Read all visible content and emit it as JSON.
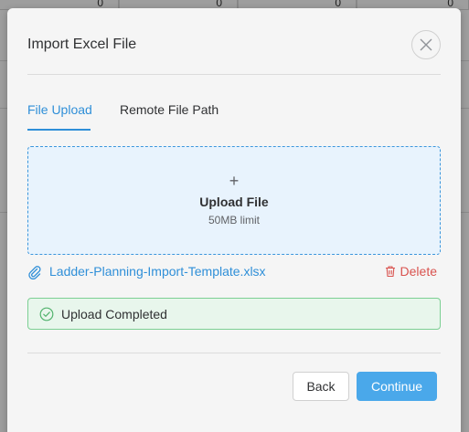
{
  "background": {
    "row_values": [
      "0",
      "0",
      "0",
      "0"
    ]
  },
  "dialog": {
    "title": "Import Excel File",
    "close_icon": "close-icon",
    "tabs": [
      {
        "label": "File Upload",
        "active": true
      },
      {
        "label": "Remote File Path",
        "active": false
      }
    ],
    "dropzone": {
      "icon": "plus-icon",
      "label": "Upload File",
      "limit": "50MB limit"
    },
    "file": {
      "icon": "paperclip-icon",
      "name": "Ladder-Planning-Import-Template.xlsx",
      "delete_icon": "trash-icon",
      "delete_label": "Delete"
    },
    "status": {
      "icon": "check-circle-icon",
      "text": "Upload Completed"
    },
    "buttons": {
      "back": "Back",
      "continue": "Continue"
    }
  },
  "colors": {
    "accent": "#2f8fd8",
    "primary_button": "#4aa8ea",
    "success_border": "#7ccf93",
    "danger": "#d9534f"
  }
}
